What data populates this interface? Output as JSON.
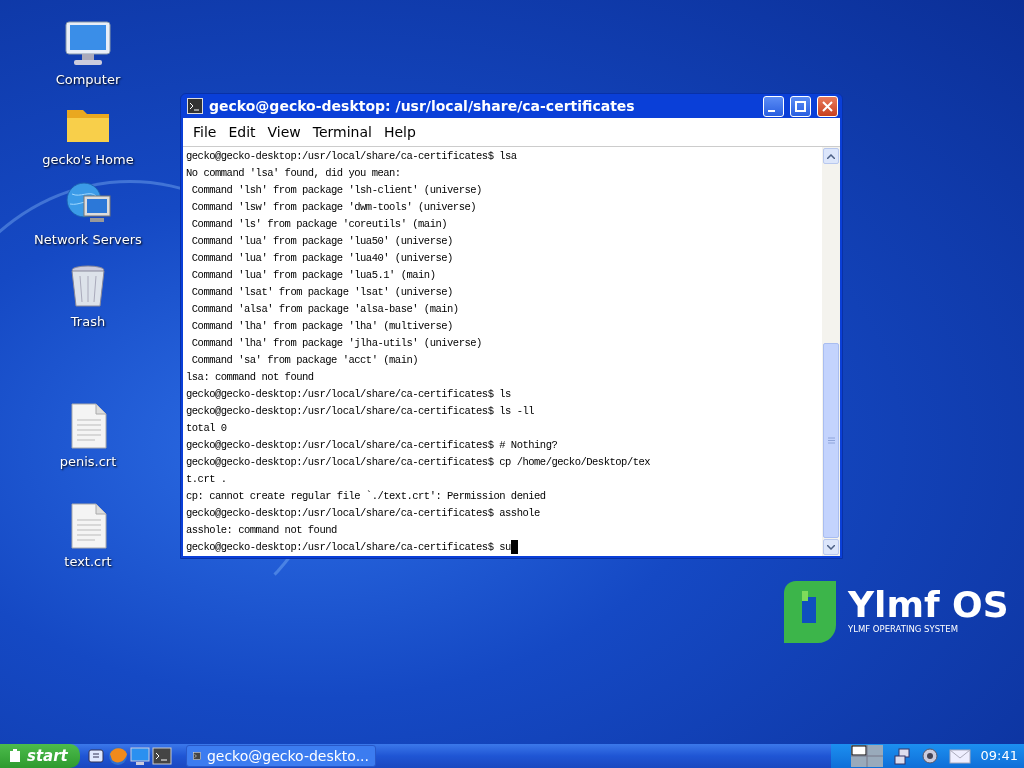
{
  "desktop_icons": [
    {
      "label": "Computer",
      "kind": "computer"
    },
    {
      "label": "gecko's Home",
      "kind": "folder"
    },
    {
      "label": "Network Servers",
      "kind": "network"
    },
    {
      "label": "Trash",
      "kind": "trash"
    },
    {
      "label": "penis.crt",
      "kind": "file"
    },
    {
      "label": "text.crt",
      "kind": "file"
    }
  ],
  "window": {
    "title": "gecko@gecko-desktop: /usr/local/share/ca-certificates",
    "menu": [
      "File",
      "Edit",
      "View",
      "Terminal",
      "Help"
    ],
    "lines": [
      "gecko@gecko-desktop:/usr/local/share/ca-certificates$ lsa",
      "No command 'lsa' found, did you mean:",
      " Command 'lsh' from package 'lsh-client' (universe)",
      " Command 'lsw' from package 'dwm-tools' (universe)",
      " Command 'ls' from package 'coreutils' (main)",
      " Command 'lua' from package 'lua50' (universe)",
      " Command 'lua' from package 'lua40' (universe)",
      " Command 'lua' from package 'lua5.1' (main)",
      " Command 'lsat' from package 'lsat' (universe)",
      " Command 'alsa' from package 'alsa-base' (main)",
      " Command 'lha' from package 'lha' (multiverse)",
      " Command 'lha' from package 'jlha-utils' (universe)",
      " Command 'sa' from package 'acct' (main)",
      "lsa: command not found",
      "gecko@gecko-desktop:/usr/local/share/ca-certificates$ ls",
      "gecko@gecko-desktop:/usr/local/share/ca-certificates$ ls -ll",
      "total 0",
      "gecko@gecko-desktop:/usr/local/share/ca-certificates$ # Nothing?",
      "gecko@gecko-desktop:/usr/local/share/ca-certificates$ cp /home/gecko/Desktop/tex",
      "t.crt .",
      "cp: cannot create regular file `./text.crt': Permission denied",
      "gecko@gecko-desktop:/usr/local/share/ca-certificates$ asshole",
      "asshole: command not found",
      "gecko@gecko-desktop:/usr/local/share/ca-certificates$ su"
    ]
  },
  "logo": {
    "name": "Ylmf OS",
    "tagline": "YLMF OPERATING SYSTEM"
  },
  "taskbar": {
    "start": "start",
    "quick_launch": [
      {
        "kind": "desktop"
      },
      {
        "kind": "browser"
      },
      {
        "kind": "monitor"
      },
      {
        "kind": "terminal"
      }
    ],
    "tasks": [
      {
        "label": "gecko@gecko-deskto...",
        "selected": false
      }
    ],
    "tray": [
      {
        "kind": "workspaces"
      },
      {
        "kind": "network"
      },
      {
        "kind": "volume"
      },
      {
        "kind": "mail"
      }
    ],
    "clock": "09:41"
  }
}
